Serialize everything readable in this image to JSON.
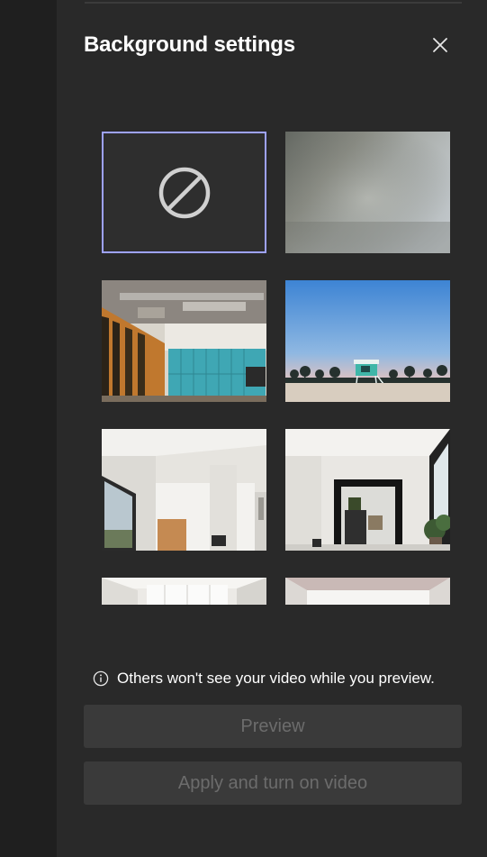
{
  "panel": {
    "title": "Background settings",
    "close_icon": "close-icon"
  },
  "backgrounds": [
    {
      "id": "none",
      "label": "No background",
      "icon": "none-icon",
      "selected": true
    },
    {
      "id": "blur",
      "label": "Blur",
      "selected": false
    },
    {
      "id": "office-lockers",
      "label": "Office with blue lockers",
      "selected": false
    },
    {
      "id": "beach-lifeguard",
      "label": "Beach lifeguard tower",
      "selected": false
    },
    {
      "id": "white-room-window",
      "label": "White room with window",
      "selected": false
    },
    {
      "id": "white-room-mirror",
      "label": "White room with mirror",
      "selected": false
    },
    {
      "id": "white-hallway",
      "label": "White hallway",
      "selected": false
    },
    {
      "id": "white-ceiling-room",
      "label": "White room",
      "selected": false
    }
  ],
  "notice": {
    "icon": "info-icon",
    "text": "Others won't see your video while you preview."
  },
  "buttons": {
    "preview": "Preview",
    "apply": "Apply and turn on video"
  },
  "colors": {
    "panel_bg": "#292929",
    "selection_border": "#9ea2ff",
    "disabled_button_bg": "#3a3a3a",
    "disabled_button_text": "#6c6c6c"
  }
}
